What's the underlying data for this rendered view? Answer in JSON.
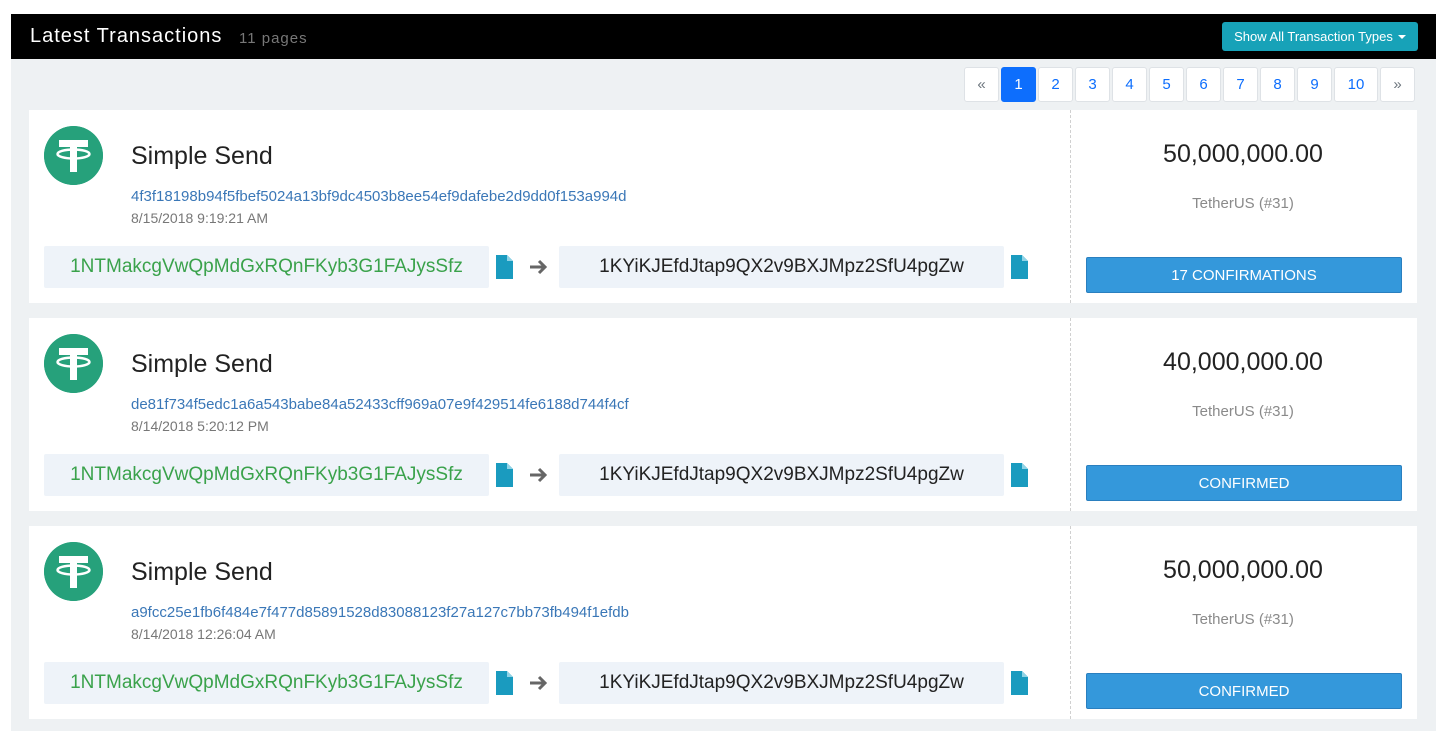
{
  "header": {
    "title": "Latest Transactions",
    "pages_text": "11 pages",
    "filter_button": "Show All Transaction Types"
  },
  "pagination": {
    "prev": "«",
    "next": "»",
    "pages": [
      "1",
      "2",
      "3",
      "4",
      "5",
      "6",
      "7",
      "8",
      "9",
      "10"
    ],
    "current": "1"
  },
  "transactions": [
    {
      "type": "Simple Send",
      "hash": "4f3f18198b94f5fbef5024a13bf9dc4503b8ee54ef9dafebe2d9dd0f153a994d",
      "time": "8/15/2018 9:19:21 AM",
      "from": "1NTMakcgVwQpMdGxRQnFKyb3G1FAJysSfz",
      "to": "1KYiKJEfdJtap9QX2v9BXJMpz2SfU4pgZw",
      "amount": "50,000,000.00",
      "token": "TetherUS (#31)",
      "status": "17 CONFIRMATIONS"
    },
    {
      "type": "Simple Send",
      "hash": "de81f734f5edc1a6a543babe84a52433cff969a07e9f429514fe6188d744f4cf",
      "time": "8/14/2018 5:20:12 PM",
      "from": "1NTMakcgVwQpMdGxRQnFKyb3G1FAJysSfz",
      "to": "1KYiKJEfdJtap9QX2v9BXJMpz2SfU4pgZw",
      "amount": "40,000,000.00",
      "token": "TetherUS (#31)",
      "status": "CONFIRMED"
    },
    {
      "type": "Simple Send",
      "hash": "a9fcc25e1fb6f484e7f477d85891528d83088123f27a127c7bb73fb494f1efdb",
      "time": "8/14/2018 12:26:04 AM",
      "from": "1NTMakcgVwQpMdGxRQnFKyb3G1FAJysSfz",
      "to": "1KYiKJEfdJtap9QX2v9BXJMpz2SfU4pgZw",
      "amount": "50,000,000.00",
      "token": "TetherUS (#31)",
      "status": "CONFIRMED"
    }
  ],
  "icons": {
    "logo": "tether-logo-icon",
    "copy": "copy-document-icon",
    "arrow": "arrow-right-icon"
  },
  "colors": {
    "header_bg": "#000000",
    "filter_button": "#17a2b8",
    "active_page": "#0d6efd",
    "tether_green": "#26a17b",
    "from_address": "#3aa24b",
    "confirm_button": "#3498db",
    "hash_link": "#3a77b7"
  }
}
